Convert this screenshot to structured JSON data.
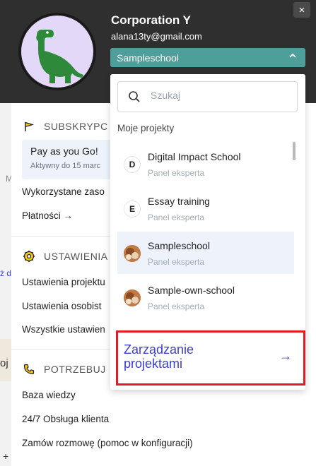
{
  "header": {
    "org_name": "Corporation Y",
    "email": "alana13ty@gmail.com",
    "selected_school": "Sampleschool",
    "close": "×"
  },
  "background": {
    "frag_m": "M",
    "frag_z": "ż d",
    "frag_oj": "oj",
    "frag_plus": "+"
  },
  "menu": {
    "subscription": {
      "heading": "SUBSKRYPC",
      "plan_name": "Pay as you Go!",
      "plan_valid": "Aktywny do 15 marc",
      "items": [
        "Wykorzystane zaso",
        "Płatności →"
      ]
    },
    "settings": {
      "heading": "USTAWIENIA",
      "items": [
        "Ustawienia projektu",
        "Ustawienia osobist",
        "Wszystkie ustawien"
      ]
    },
    "needs": {
      "heading": "POTRZEBUJ",
      "items": [
        "Baza wiedzy",
        "24/7 Obsługa klienta",
        "Zamów rozmowę (pomoc w konfiguracji)"
      ]
    }
  },
  "dropdown": {
    "search_placeholder": "Szukaj",
    "list_title": "Moje projekty",
    "projects": [
      {
        "badge": "D",
        "name": "Digital Impact School",
        "role": "Panel eksperta"
      },
      {
        "badge": "E",
        "name": "Essay training",
        "role": "Panel eksperta"
      },
      {
        "badge": "",
        "name": "Sampleschool",
        "role": "Panel eksperta"
      },
      {
        "badge": "",
        "name": "Sample-own-school",
        "role": "Panel eksperta"
      }
    ],
    "manage_label": "Zarządzanie projektami",
    "manage_arrow": "→"
  },
  "colors": {
    "header_bg": "#2f2f2f",
    "select_bg": "#4e9e9c",
    "accent_link": "#3a3fd1",
    "highlight_border": "#e01b24"
  },
  "icons": {
    "flag": "flag-icon",
    "gear": "gear-icon",
    "phone": "phone-icon",
    "search": "search-icon",
    "close": "close-icon",
    "chevron": "chevron-up-icon"
  }
}
